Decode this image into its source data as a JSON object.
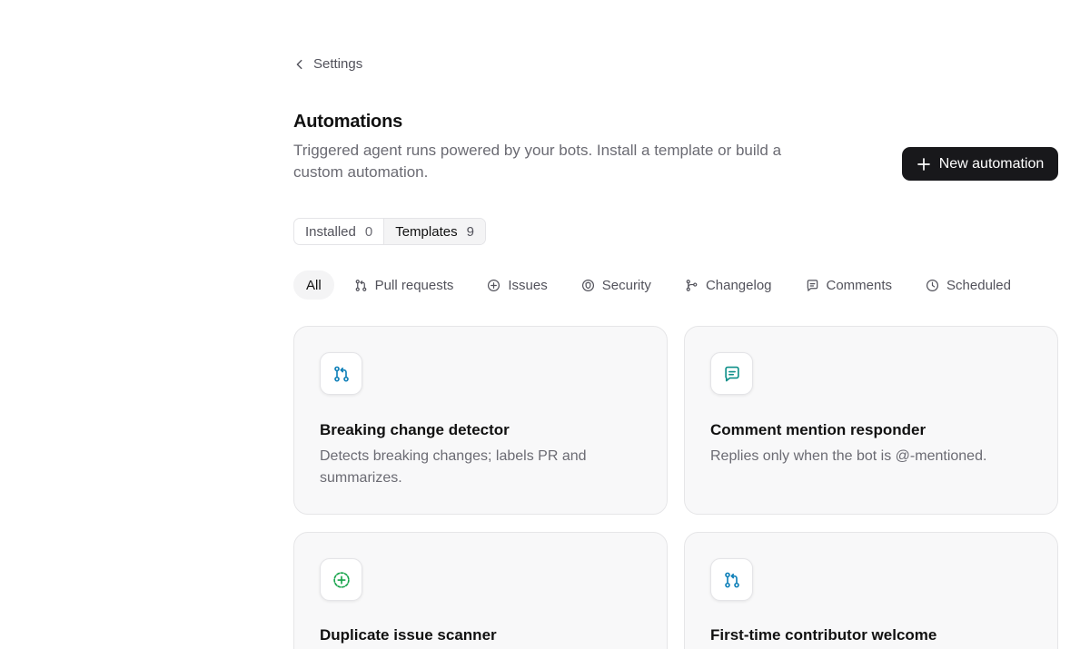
{
  "nav": {
    "back_label": "Settings",
    "back_icon": "chevron-left-icon"
  },
  "header": {
    "title": "Automations",
    "subtitle": "Triggered agent runs powered by your bots. Install a template or build a custom automation.",
    "new_button_label": "New automation",
    "new_button_icon": "plus-icon"
  },
  "tabs": [
    {
      "label": "Installed",
      "count": "0",
      "active": false
    },
    {
      "label": "Templates",
      "count": "9",
      "active": true
    }
  ],
  "filters": {
    "all_label": "All",
    "items": [
      {
        "label": "Pull requests",
        "icon": "git-pull-request-icon"
      },
      {
        "label": "Issues",
        "icon": "issue-icon"
      },
      {
        "label": "Security",
        "icon": "security-icon"
      },
      {
        "label": "Changelog",
        "icon": "git-branch-icon"
      },
      {
        "label": "Comments",
        "icon": "comment-icon"
      },
      {
        "label": "Scheduled",
        "icon": "clock-icon"
      }
    ]
  },
  "templates": [
    {
      "title": "Breaking change detector",
      "description": "Detects breaking changes; labels PR and summarizes.",
      "icon": "git-pull-request-icon",
      "icon_color": "#0e7fb8"
    },
    {
      "title": "Comment mention responder",
      "description": "Replies only when the bot is @-mentioned.",
      "icon": "comment-icon",
      "icon_color": "#0d8f88"
    },
    {
      "title": "Duplicate issue scanner",
      "description": "",
      "icon": "issue-icon",
      "icon_color": "#16a34a"
    },
    {
      "title": "First-time contributor welcome",
      "description": "",
      "icon": "git-pull-request-icon",
      "icon_color": "#0e7fb8"
    }
  ],
  "colors": {
    "primary_button": "#18181b",
    "pull_request_accent": "#0e7fb8",
    "comment_accent": "#0d8f88",
    "issue_accent": "#16a34a"
  }
}
